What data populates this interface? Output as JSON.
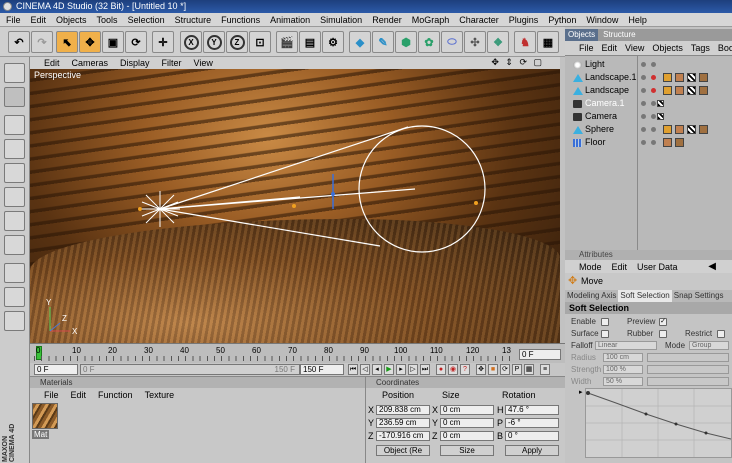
{
  "window": {
    "title": "CINEMA 4D Studio (32 Bit) - [Untitled 10 *]"
  },
  "menubar": [
    "File",
    "Edit",
    "Objects",
    "Tools",
    "Selection",
    "Structure",
    "Functions",
    "Animation",
    "Simulation",
    "Render",
    "MoGraph",
    "Character",
    "Plugins",
    "Python",
    "Window",
    "Help"
  ],
  "viewport": {
    "menu": [
      "Edit",
      "Cameras",
      "Display",
      "Filter",
      "View"
    ],
    "label": "Perspective",
    "nav_icons": "✥ ⇕ ⟳ ▢"
  },
  "timeline": {
    "ticks": [
      "0",
      "10",
      "20",
      "30",
      "40",
      "50",
      "60",
      "70",
      "80",
      "90",
      "100",
      "110",
      "120",
      "13"
    ],
    "frame_field": "0 F"
  },
  "playback": {
    "start": "0 F",
    "end": "150 F",
    "range_start": "0 F",
    "range_end": "150 F"
  },
  "materials": {
    "header": "Materials",
    "menu": [
      "File",
      "Edit",
      "Function",
      "Texture"
    ],
    "swatch_label": "Mat"
  },
  "coordinates": {
    "header": "Coordinates",
    "col_position": "Position",
    "col_size": "Size",
    "col_rotation": "Rotation",
    "rows": [
      {
        "axis": "X",
        "pos": "209.838 cm",
        "size_axis": "X",
        "size": "0 cm",
        "rot_axis": "H",
        "rot": "47.6 °"
      },
      {
        "axis": "Y",
        "pos": "236.59 cm",
        "size_axis": "Y",
        "size": "0 cm",
        "rot_axis": "P",
        "rot": "-6 °"
      },
      {
        "axis": "Z",
        "pos": "-170.916 cm",
        "size_axis": "Z",
        "size": "0 cm",
        "rot_axis": "B",
        "rot": "0 °"
      }
    ],
    "mode_select": "Object (Re",
    "size_select": "Size",
    "apply_label": "Apply"
  },
  "objects_panel": {
    "tabs": [
      "Objects",
      "Structure"
    ],
    "menu": [
      "File",
      "Edit",
      "View",
      "Objects",
      "Tags",
      "Bookm"
    ],
    "items": [
      {
        "name": "Light",
        "selected": false
      },
      {
        "name": "Landscape.1",
        "selected": false
      },
      {
        "name": "Landscape",
        "selected": false
      },
      {
        "name": "Camera.1",
        "selected": true
      },
      {
        "name": "Camera",
        "selected": false
      },
      {
        "name": "Sphere",
        "selected": false
      },
      {
        "name": "Floor",
        "selected": false
      }
    ]
  },
  "attributes": {
    "header": "Attributes",
    "menu": [
      "Mode",
      "Edit",
      "User Data"
    ],
    "tool_name": "Move",
    "tabs": [
      "Modeling Axis",
      "Soft Selection",
      "Snap Settings"
    ],
    "section": "Soft Selection",
    "enable": "Enable",
    "preview": "Preview",
    "surface": "Surface",
    "rubber": "Rubber",
    "restrict": "Restrict",
    "falloff_label": "Falloff",
    "falloff_value": "Linear",
    "mode_label": "Mode",
    "mode_value": "Group",
    "radius_label": "Radius",
    "radius_value": "100 cm",
    "strength_label": "Strength",
    "strength_value": "100 %",
    "width_label": "Width",
    "width_value": "50 %"
  },
  "colors": {
    "accent_orange": "#f0b04a",
    "selected_object": "#ffffff",
    "title_blue": "#2c5aa8"
  }
}
